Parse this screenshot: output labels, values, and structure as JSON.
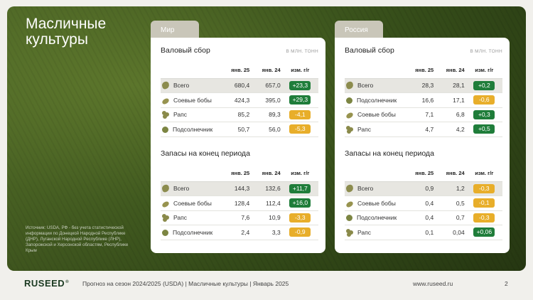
{
  "slide": {
    "title": "Масличные культуры",
    "source": "Источник: USDA, РФ - без учета статистической информации по Донецкой Народной Республике (ДНР), Луганской Народной Республике (ЛНР), Запорожской и Херсонской областям, Республике Крым"
  },
  "world": {
    "tab": "Мир",
    "production": {
      "title": "Валовый сбор",
      "unit": "В МЛН. ТОНН",
      "headers": [
        "",
        "янв. 25",
        "янв. 24",
        "изм. г/г"
      ],
      "rows": [
        {
          "icon": "total-blob-icon",
          "name": "Всего",
          "v25": "680,4",
          "v24": "657,0",
          "chg": "+23,3",
          "dir": "pos"
        },
        {
          "icon": "soybean-icon",
          "name": "Соевые бобы",
          "v25": "424,3",
          "v24": "395,0",
          "chg": "+29,3",
          "dir": "pos"
        },
        {
          "icon": "rapeseed-icon",
          "name": "Рапс",
          "v25": "85,2",
          "v24": "89,3",
          "chg": "-4,1",
          "dir": "neg"
        },
        {
          "icon": "sunflower-icon",
          "name": "Подсолнечник",
          "v25": "50,7",
          "v24": "56,0",
          "chg": "-5,3",
          "dir": "neg"
        }
      ]
    },
    "stocks": {
      "title": "Запасы на конец периода",
      "headers": [
        "",
        "янв. 25",
        "янв. 24",
        "изм. г/г"
      ],
      "rows": [
        {
          "icon": "total-blob-icon",
          "name": "Всего",
          "v25": "144,3",
          "v24": "132,6",
          "chg": "+11,7",
          "dir": "pos"
        },
        {
          "icon": "soybean-icon",
          "name": "Соевые бобы",
          "v25": "128,4",
          "v24": "112,4",
          "chg": "+16,0",
          "dir": "pos"
        },
        {
          "icon": "rapeseed-icon",
          "name": "Рапс",
          "v25": "7,6",
          "v24": "10,9",
          "chg": "-3,3",
          "dir": "neg"
        },
        {
          "icon": "sunflower-icon",
          "name": "Подсолнечник",
          "v25": "2,4",
          "v24": "3,3",
          "chg": "-0,9",
          "dir": "neg"
        }
      ]
    }
  },
  "russia": {
    "tab": "Россия",
    "production": {
      "title": "Валовый сбор",
      "unit": "В МЛН. ТОНН",
      "headers": [
        "",
        "янв. 25",
        "янв. 24",
        "изм. г/г"
      ],
      "rows": [
        {
          "icon": "total-blob-icon",
          "name": "Всего",
          "v25": "28,3",
          "v24": "28,1",
          "chg": "+0,2",
          "dir": "pos"
        },
        {
          "icon": "sunflower-icon",
          "name": "Подсолнечник",
          "v25": "16,6",
          "v24": "17,1",
          "chg": "-0,6",
          "dir": "neg"
        },
        {
          "icon": "soybean-icon",
          "name": "Соевые бобы",
          "v25": "7,1",
          "v24": "6,8",
          "chg": "+0,3",
          "dir": "pos"
        },
        {
          "icon": "rapeseed-icon",
          "name": "Рапс",
          "v25": "4,7",
          "v24": "4,2",
          "chg": "+0,5",
          "dir": "pos"
        }
      ]
    },
    "stocks": {
      "title": "Запасы на конец периода",
      "headers": [
        "",
        "янв. 25",
        "янв. 24",
        "изм. г/г"
      ],
      "rows": [
        {
          "icon": "total-blob-icon",
          "name": "Всего",
          "v25": "0,9",
          "v24": "1,2",
          "chg": "-0,3",
          "dir": "neg"
        },
        {
          "icon": "soybean-icon",
          "name": "Соевые бобы",
          "v25": "0,4",
          "v24": "0,5",
          "chg": "-0,1",
          "dir": "neg"
        },
        {
          "icon": "sunflower-icon",
          "name": "Подсолнечник",
          "v25": "0,4",
          "v24": "0,7",
          "chg": "-0,3",
          "dir": "neg"
        },
        {
          "icon": "rapeseed-icon",
          "name": "Рапс",
          "v25": "0,1",
          "v24": "0,04",
          "chg": "+0,06",
          "dir": "pos"
        }
      ]
    }
  },
  "footer": {
    "logo": "RUSEED",
    "logo_mark": "®",
    "text": "Прогноз на сезон 2024/2025 (USDA)  |  Масличные культуры  |  Январь 2025",
    "url": "www.ruseed.ru",
    "page": "2"
  },
  "colors": {
    "positive": "#1f7d3a",
    "negative": "#e8ae2a",
    "brand": "#1b3a21"
  }
}
